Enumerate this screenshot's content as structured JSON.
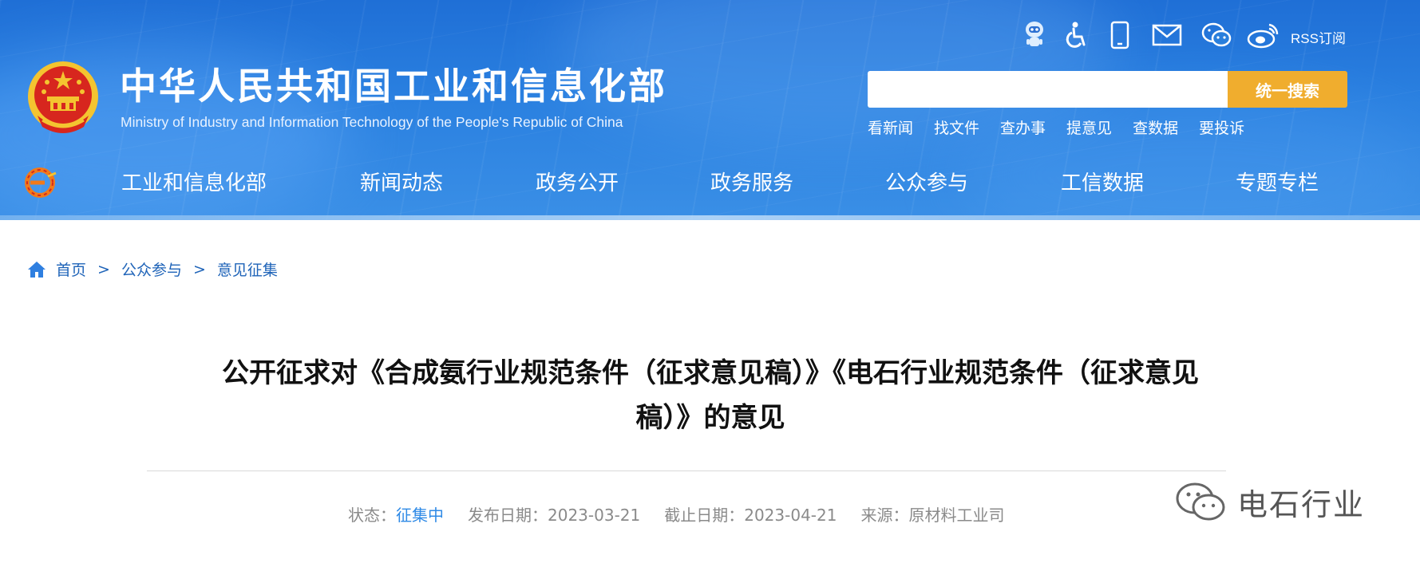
{
  "site": {
    "title": "中华人民共和国工业和信息化部",
    "subtitle": "Ministry of Industry and Information Technology of the People's Republic of China"
  },
  "utility": {
    "rss_label": "RSS订阅",
    "icons": [
      "robot-assistant-icon",
      "accessibility-icon",
      "mobile-icon",
      "mail-icon",
      "wechat-icon",
      "weibo-icon"
    ]
  },
  "search": {
    "placeholder": "",
    "value": "",
    "button_label": "统一搜索"
  },
  "quick_links": [
    "看新闻",
    "找文件",
    "查办事",
    "提意见",
    "查数据",
    "要投诉"
  ],
  "nav": [
    "工业和信息化部",
    "新闻动态",
    "政务公开",
    "政务服务",
    "公众参与",
    "工信数据",
    "专题专栏"
  ],
  "breadcrumb": [
    "首页",
    "公众参与",
    "意见征集"
  ],
  "breadcrumb_sep": ">",
  "article": {
    "title_line1": "公开征求对《合成氨行业规范条件（征求意见稿）》《电石行业规范条件（征求意见",
    "title_line2": "稿）》的意见",
    "status_label": "状态：",
    "status_value": "征集中",
    "publish_label": "发布日期：",
    "publish_date": "2023-03-21",
    "deadline_label": "截止日期：",
    "deadline_date": "2023-04-21",
    "source_label": "来源：",
    "source_value": "原材料工业司"
  },
  "watermark": {
    "text": "电石行业"
  },
  "colors": {
    "header": "#2a80e0",
    "search_button": "#f0ad2e",
    "link": "#1e63b8",
    "status": "#2f8ae6"
  }
}
